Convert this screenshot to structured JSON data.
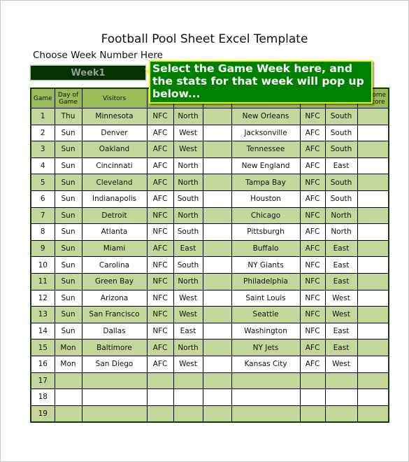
{
  "title": "Football Pool Sheet Excel Template",
  "week_selector": {
    "label": "Choose Week Number Here",
    "selected": "Week1"
  },
  "callout": {
    "text": "Select the Game Week here, and the stats for that week will pop up below..."
  },
  "colors": {
    "header_bg": "#9bbb59",
    "alt_row_bg": "#c4d79b",
    "callout_bg": "#008000",
    "callout_border": "#f5f500",
    "selector_bg": "#003300"
  },
  "table": {
    "headers": [
      "Game",
      "Day of Game",
      "Visitors",
      "",
      "",
      "",
      "",
      "",
      "",
      "Home Score"
    ],
    "headers_visible_partial": {
      "score": "...ne ...re"
    },
    "rows": [
      {
        "game": "1",
        "day": "Thu",
        "visitor": "Minnesota",
        "v_conf": "NFC",
        "v_div": "North",
        "blank": "",
        "home": "New Orleans",
        "h_conf": "NFC",
        "h_div": "South",
        "score": ""
      },
      {
        "game": "2",
        "day": "Sun",
        "visitor": "Denver",
        "v_conf": "AFC",
        "v_div": "West",
        "blank": "",
        "home": "Jacksonville",
        "h_conf": "AFC",
        "h_div": "South",
        "score": ""
      },
      {
        "game": "3",
        "day": "Sun",
        "visitor": "Oakland",
        "v_conf": "AFC",
        "v_div": "West",
        "blank": "",
        "home": "Tennessee",
        "h_conf": "AFC",
        "h_div": "South",
        "score": ""
      },
      {
        "game": "4",
        "day": "Sun",
        "visitor": "Cincinnati",
        "v_conf": "AFC",
        "v_div": "North",
        "blank": "",
        "home": "New England",
        "h_conf": "AFC",
        "h_div": "East",
        "score": ""
      },
      {
        "game": "5",
        "day": "Sun",
        "visitor": "Cleveland",
        "v_conf": "AFC",
        "v_div": "North",
        "blank": "",
        "home": "Tampa Bay",
        "h_conf": "NFC",
        "h_div": "South",
        "score": ""
      },
      {
        "game": "6",
        "day": "Sun",
        "visitor": "Indianapolis",
        "v_conf": "AFC",
        "v_div": "South",
        "blank": "",
        "home": "Houston",
        "h_conf": "AFC",
        "h_div": "South",
        "score": ""
      },
      {
        "game": "7",
        "day": "Sun",
        "visitor": "Detroit",
        "v_conf": "NFC",
        "v_div": "North",
        "blank": "",
        "home": "Chicago",
        "h_conf": "NFC",
        "h_div": "North",
        "score": ""
      },
      {
        "game": "8",
        "day": "Sun",
        "visitor": "Atlanta",
        "v_conf": "NFC",
        "v_div": "South",
        "blank": "",
        "home": "Pittsburgh",
        "h_conf": "AFC",
        "h_div": "North",
        "score": ""
      },
      {
        "game": "9",
        "day": "Sun",
        "visitor": "Miami",
        "v_conf": "AFC",
        "v_div": "East",
        "blank": "",
        "home": "Buffalo",
        "h_conf": "AFC",
        "h_div": "East",
        "score": ""
      },
      {
        "game": "10",
        "day": "Sun",
        "visitor": "Carolina",
        "v_conf": "NFC",
        "v_div": "South",
        "blank": "",
        "home": "NY Giants",
        "h_conf": "NFC",
        "h_div": "East",
        "score": ""
      },
      {
        "game": "11",
        "day": "Sun",
        "visitor": "Green Bay",
        "v_conf": "NFC",
        "v_div": "North",
        "blank": "",
        "home": "Philadelphia",
        "h_conf": "NFC",
        "h_div": "East",
        "score": ""
      },
      {
        "game": "12",
        "day": "Sun",
        "visitor": "Arizona",
        "v_conf": "NFC",
        "v_div": "West",
        "blank": "",
        "home": "Saint Louis",
        "h_conf": "NFC",
        "h_div": "West",
        "score": ""
      },
      {
        "game": "13",
        "day": "Sun",
        "visitor": "San Francisco",
        "v_conf": "NFC",
        "v_div": "West",
        "blank": "",
        "home": "Seattle",
        "h_conf": "NFC",
        "h_div": "West",
        "score": ""
      },
      {
        "game": "14",
        "day": "Sun",
        "visitor": "Dallas",
        "v_conf": "NFC",
        "v_div": "East",
        "blank": "",
        "home": "Washington",
        "h_conf": "NFC",
        "h_div": "East",
        "score": ""
      },
      {
        "game": "15",
        "day": "Mon",
        "visitor": "Baltimore",
        "v_conf": "AFC",
        "v_div": "North",
        "blank": "",
        "home": "NY Jets",
        "h_conf": "AFC",
        "h_div": "East",
        "score": ""
      },
      {
        "game": "16",
        "day": "Mon",
        "visitor": "San Diego",
        "v_conf": "AFC",
        "v_div": "West",
        "blank": "",
        "home": "Kansas City",
        "h_conf": "AFC",
        "h_div": "West",
        "score": ""
      },
      {
        "game": "17",
        "day": "",
        "visitor": "",
        "v_conf": "",
        "v_div": "",
        "blank": "",
        "home": "",
        "h_conf": "",
        "h_div": "",
        "score": ""
      },
      {
        "game": "18",
        "day": "",
        "visitor": "",
        "v_conf": "",
        "v_div": "",
        "blank": "",
        "home": "",
        "h_conf": "",
        "h_div": "",
        "score": ""
      },
      {
        "game": "19",
        "day": "",
        "visitor": "",
        "v_conf": "",
        "v_div": "",
        "blank": "",
        "home": "",
        "h_conf": "",
        "h_div": "",
        "score": ""
      }
    ]
  }
}
